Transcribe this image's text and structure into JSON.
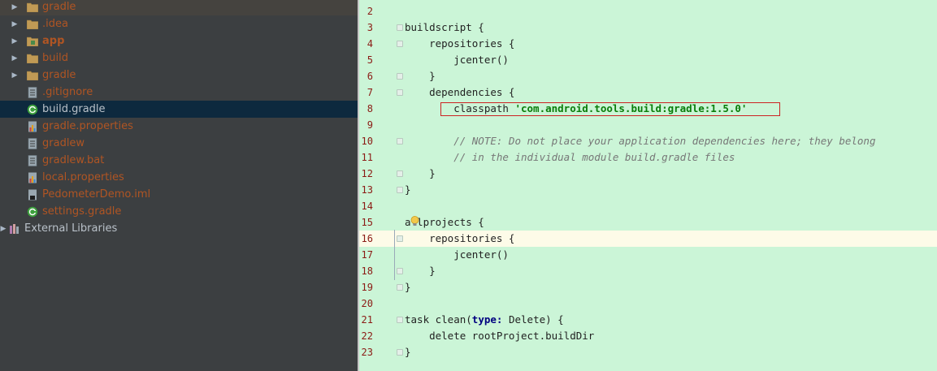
{
  "project_tree": {
    "items": [
      {
        "label": "gradle",
        "icon": "folder-icon",
        "expandable": true,
        "color": "#b05523"
      },
      {
        "label": ".idea",
        "icon": "folder-icon",
        "expandable": true,
        "color": "#b05523"
      },
      {
        "label": "app",
        "icon": "module-folder-icon",
        "expandable": true,
        "color": "#b05523",
        "bold": true
      },
      {
        "label": "build",
        "icon": "folder-icon",
        "expandable": true,
        "color": "#b05523"
      },
      {
        "label": "gradle",
        "icon": "folder-icon",
        "expandable": true,
        "color": "#b05523"
      },
      {
        "label": ".gitignore",
        "icon": "text-file-icon",
        "expandable": false,
        "color": "#b05523"
      },
      {
        "label": "build.gradle",
        "icon": "gradle-file-icon",
        "expandable": false,
        "color": "#b9c1c9",
        "selected": true
      },
      {
        "label": "gradle.properties",
        "icon": "properties-file-icon",
        "expandable": false,
        "color": "#b05523"
      },
      {
        "label": "gradlew",
        "icon": "text-file-icon",
        "expandable": false,
        "color": "#b05523"
      },
      {
        "label": "gradlew.bat",
        "icon": "text-file-icon",
        "expandable": false,
        "color": "#b05523"
      },
      {
        "label": "local.properties",
        "icon": "properties-file-icon",
        "expandable": false,
        "color": "#b05523"
      },
      {
        "label": "PedometerDemo.iml",
        "icon": "iml-file-icon",
        "expandable": false,
        "color": "#b05523"
      },
      {
        "label": "settings.gradle",
        "icon": "gradle-file-icon",
        "expandable": false,
        "color": "#b05523"
      }
    ],
    "external_libraries": {
      "label": "External Libraries",
      "icon": "libraries-icon"
    }
  },
  "editor": {
    "lines": [
      {
        "num": "2",
        "code": ""
      },
      {
        "num": "3",
        "code": "buildscript {"
      },
      {
        "num": "4",
        "code": "    repositories {"
      },
      {
        "num": "5",
        "code": "        jcenter()"
      },
      {
        "num": "6",
        "code": "    }"
      },
      {
        "num": "7",
        "code": "    dependencies {"
      },
      {
        "num": "8",
        "code_pre": "        classpath ",
        "code_str": "'com.android.tools.build:gradle:1.5.0'"
      },
      {
        "num": "9",
        "code": ""
      },
      {
        "num": "10",
        "code_cmt": "        // NOTE: Do not place your application dependencies here; they belong"
      },
      {
        "num": "11",
        "code_cmt": "        // in the individual module build.gradle files"
      },
      {
        "num": "12",
        "code": "    }"
      },
      {
        "num": "13",
        "code": "}"
      },
      {
        "num": "14",
        "code": ""
      },
      {
        "num": "15",
        "code": "allprojects {"
      },
      {
        "num": "16",
        "code": "    repositories {"
      },
      {
        "num": "17",
        "code": "        jcenter()"
      },
      {
        "num": "18",
        "code": "    }"
      },
      {
        "num": "19",
        "code": "}"
      },
      {
        "num": "20",
        "code": ""
      },
      {
        "num": "21",
        "code_pre": "task clean(",
        "code_kw": "type:",
        "code_post": " Delete) {"
      },
      {
        "num": "22",
        "code": "    delete rootProject.buildDir"
      },
      {
        "num": "23",
        "code": "}"
      }
    ],
    "caret_line": "16",
    "highlight_line": "8"
  },
  "colors": {
    "editor_bg": "#cbf5d7",
    "panel_bg": "#3c3f41",
    "selected_row": "#0d293e",
    "line_number": "#8b1a14",
    "highlight_border": "#cc2222"
  }
}
